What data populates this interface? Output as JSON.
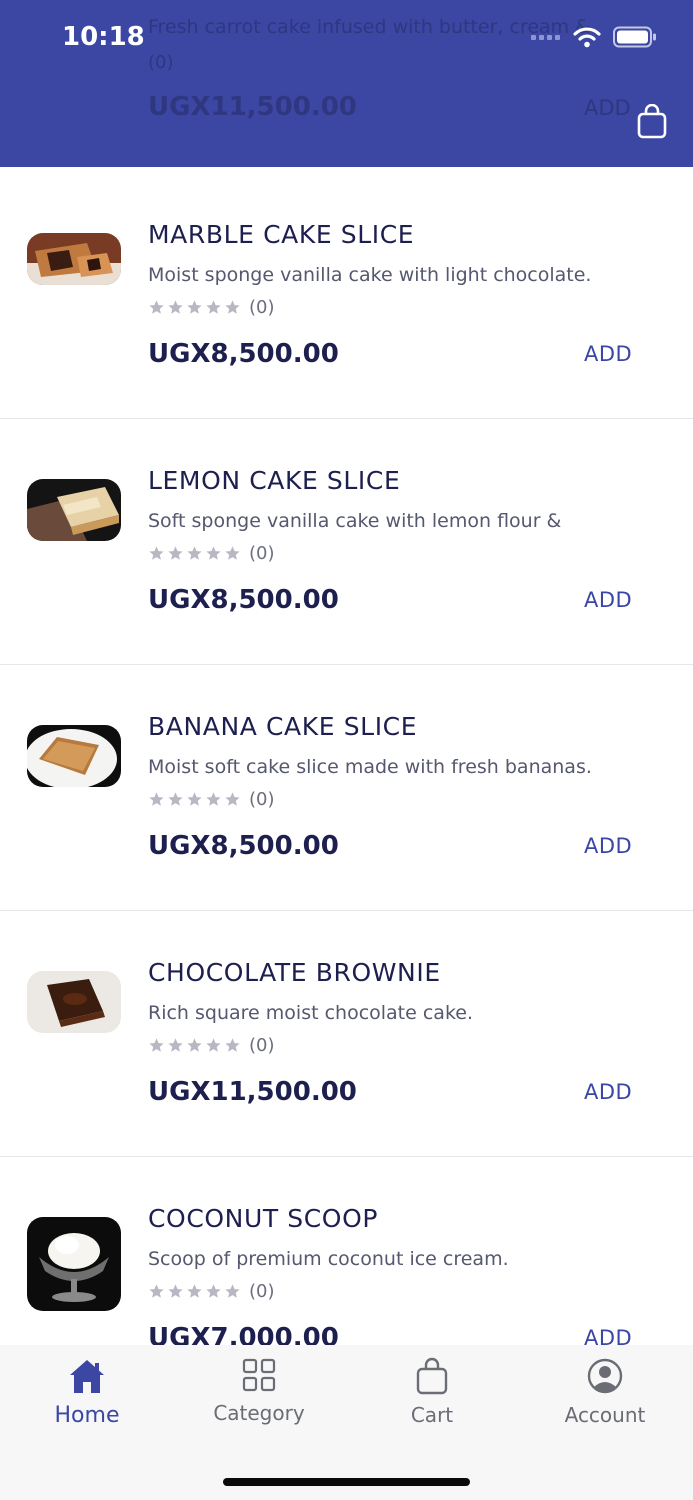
{
  "status_bar": {
    "time": "10:18"
  },
  "header": {
    "ghost_item": {
      "desc": "Fresh carrot cake infused with butter, cream &",
      "rating_count": "(0)",
      "price": "UGX11,500.00",
      "add_label": "ADD"
    }
  },
  "products": [
    {
      "title": "MARBLE CAKE SLICE",
      "desc": "Moist sponge vanilla cake with light chocolate.",
      "rating_count": "(0)",
      "price": "UGX8,500.00",
      "add_label": "ADD",
      "image": "marble-cake-photo"
    },
    {
      "title": "LEMON CAKE SLICE",
      "desc": "Soft sponge vanilla cake with lemon flour &",
      "rating_count": "(0)",
      "price": "UGX8,500.00",
      "add_label": "ADD",
      "image": "lemon-cake-photo"
    },
    {
      "title": "BANANA CAKE SLICE",
      "desc": "Moist soft cake slice made with fresh bananas.",
      "rating_count": "(0)",
      "price": "UGX8,500.00",
      "add_label": "ADD",
      "image": "banana-cake-photo"
    },
    {
      "title": "CHOCOLATE BROWNIE",
      "desc": "Rich square moist chocolate cake.",
      "rating_count": "(0)",
      "price": "UGX11,500.00",
      "add_label": "ADD",
      "image": "brownie-photo"
    },
    {
      "title": "COCONUT SCOOP",
      "desc": "Scoop of premium coconut ice cream.",
      "rating_count": "(0)",
      "price": "UGX7,000.00",
      "add_label": "ADD",
      "image": "coconut-ice-cream-photo"
    }
  ],
  "tabbar": {
    "items": [
      {
        "label": "Home",
        "icon": "home-icon",
        "active": true
      },
      {
        "label": "Category",
        "icon": "grid-icon",
        "active": false
      },
      {
        "label": "Cart",
        "icon": "bag-icon",
        "active": false
      },
      {
        "label": "Account",
        "icon": "user-circle-icon",
        "active": false
      }
    ]
  },
  "colors": {
    "header_bg": "#3b47a2",
    "accent": "#3b47a2",
    "text_dark": "#1d1f4f",
    "star_gray": "#b7b8c2"
  }
}
